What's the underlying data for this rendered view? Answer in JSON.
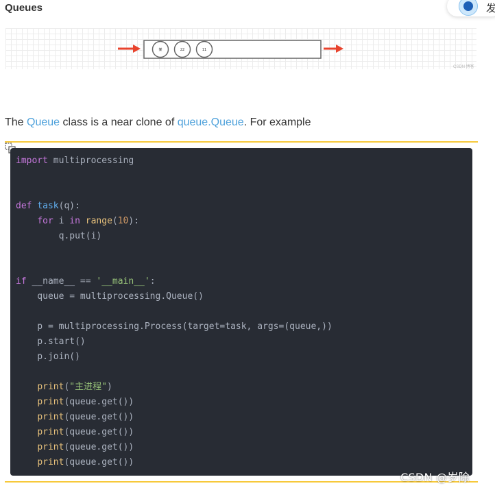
{
  "section": {
    "title": "Queues"
  },
  "float_widget": {
    "text": "发"
  },
  "figure": {
    "items": [
      "某",
      "22",
      "11"
    ],
    "caption": "CSDN 博客"
  },
  "paragraph": {
    "part1": "The ",
    "link1": "Queue",
    "part2": " class is a near clone of ",
    "link2": "queue.Queue",
    "part3": ". For example"
  },
  "code": {
    "lines": [
      [
        {
          "t": "import",
          "c": "kw"
        },
        {
          "t": " multiprocessing",
          "c": ""
        }
      ],
      [],
      [],
      [
        {
          "t": "def",
          "c": "kw"
        },
        {
          "t": " ",
          "c": ""
        },
        {
          "t": "task",
          "c": "fn"
        },
        {
          "t": "(q):",
          "c": ""
        }
      ],
      [
        {
          "t": "    ",
          "c": ""
        },
        {
          "t": "for",
          "c": "kw"
        },
        {
          "t": " i ",
          "c": ""
        },
        {
          "t": "in",
          "c": "kw"
        },
        {
          "t": " ",
          "c": ""
        },
        {
          "t": "range",
          "c": "bi"
        },
        {
          "t": "(",
          "c": ""
        },
        {
          "t": "10",
          "c": "num"
        },
        {
          "t": "):",
          "c": ""
        }
      ],
      [
        {
          "t": "        q.put(i)",
          "c": ""
        }
      ],
      [],
      [],
      [
        {
          "t": "if",
          "c": "kw"
        },
        {
          "t": " __name__ == ",
          "c": ""
        },
        {
          "t": "'__main__'",
          "c": "str"
        },
        {
          "t": ":",
          "c": ""
        }
      ],
      [
        {
          "t": "    queue = multiprocessing.Queue()",
          "c": ""
        }
      ],
      [],
      [
        {
          "t": "    p = multiprocessing.Process(target=task, args=(queue,))",
          "c": ""
        }
      ],
      [
        {
          "t": "    p.start()",
          "c": ""
        }
      ],
      [
        {
          "t": "    p.join()",
          "c": ""
        }
      ],
      [],
      [
        {
          "t": "    ",
          "c": ""
        },
        {
          "t": "print",
          "c": "bi"
        },
        {
          "t": "(",
          "c": ""
        },
        {
          "t": "\"主进程\"",
          "c": "str"
        },
        {
          "t": ")",
          "c": ""
        }
      ],
      [
        {
          "t": "    ",
          "c": ""
        },
        {
          "t": "print",
          "c": "bi"
        },
        {
          "t": "(queue.get())",
          "c": ""
        }
      ],
      [
        {
          "t": "    ",
          "c": ""
        },
        {
          "t": "print",
          "c": "bi"
        },
        {
          "t": "(queue.get())",
          "c": ""
        }
      ],
      [
        {
          "t": "    ",
          "c": ""
        },
        {
          "t": "print",
          "c": "bi"
        },
        {
          "t": "(queue.get())",
          "c": ""
        }
      ],
      [
        {
          "t": "    ",
          "c": ""
        },
        {
          "t": "print",
          "c": "bi"
        },
        {
          "t": "(queue.get())",
          "c": ""
        }
      ],
      [
        {
          "t": "    ",
          "c": ""
        },
        {
          "t": "print",
          "c": "bi"
        },
        {
          "t": "(queue.get())",
          "c": ""
        }
      ]
    ]
  },
  "watermark": {
    "text": "CSDN @岁除"
  },
  "colors": {
    "link": "#4ea1db",
    "code_bg": "#282c34",
    "rule": "#f7c93b",
    "arrow": "#e8432d"
  }
}
